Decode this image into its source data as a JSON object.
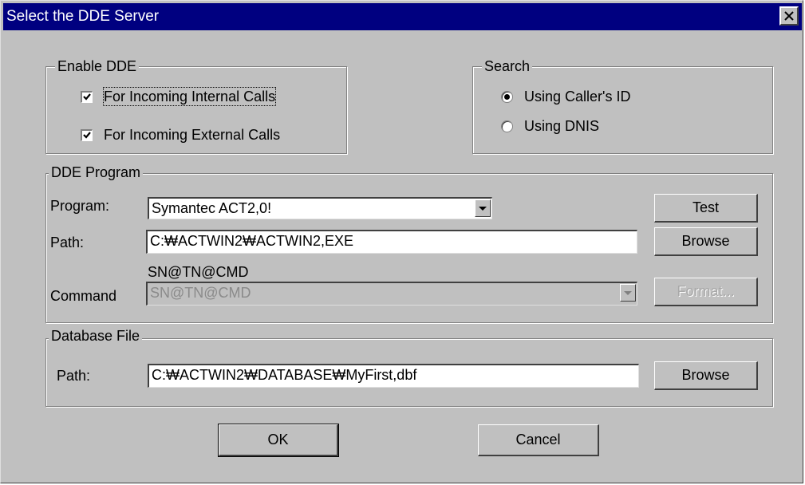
{
  "window": {
    "title": "Select the DDE Server"
  },
  "enable_dde": {
    "legend": "Enable DDE",
    "incoming_internal": {
      "label": "For Incoming Internal Calls",
      "checked": true
    },
    "incoming_external": {
      "label": "For Incoming External Calls",
      "checked": true
    }
  },
  "search": {
    "legend": "Search",
    "options": [
      {
        "label": "Using Caller's ID",
        "selected": true
      },
      {
        "label": "Using DNIS",
        "selected": false
      }
    ]
  },
  "dde_program": {
    "legend": "DDE Program",
    "program_label": "Program:",
    "program_value": "Symantec ACT2,0!",
    "path_label": "Path:",
    "path_value": "C:₩ACTWIN2₩ACTWIN2,EXE",
    "command_hint": "SN@TN@CMD",
    "command_label": "Command",
    "command_value": "SN@TN@CMD",
    "test_label": "Test",
    "browse_label": "Browse",
    "format_label": "Format..."
  },
  "database_file": {
    "legend": "Database File",
    "path_label": "Path:",
    "path_value": "C:₩ACTWIN2₩DATABASE₩MyFirst,dbf",
    "browse_label": "Browse"
  },
  "buttons": {
    "ok": "OK",
    "cancel": "Cancel"
  }
}
